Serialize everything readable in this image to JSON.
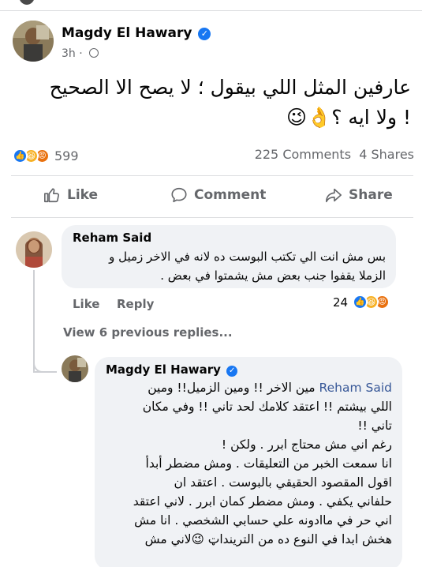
{
  "post": {
    "author": "Magdy El Hawary",
    "time": "3h",
    "text_line1": "عارفين المثل اللي بيقول ؛ لا يصح الا الصحيح",
    "text_line2": "! ولا ايه ؟👌😉"
  },
  "stats": {
    "reaction_count": "599",
    "comments": "225 Comments",
    "shares": "4 Shares"
  },
  "actions": {
    "like": "Like",
    "comment": "Comment",
    "share": "Share"
  },
  "comment": {
    "author": "Reham Said",
    "line1": "بس مش انت الي تكتب البوست ده لانه في الاخر زميل و",
    "line2": "الزملا يقفوا جنب بعض مش يشمتوا في بعض .",
    "like_label": "Like",
    "reply_label": "Reply",
    "reaction_count": "24"
  },
  "previous_replies": "View 6 previous replies...",
  "reply": {
    "author": "Magdy El Hawary",
    "mention": "Reham Said",
    "line1_rest": " مين الاخر !! ومين الزميل!! ومين",
    "line2": "اللي بيشتم !! اعتقد كلامك لحد تاني !! وفي مكان",
    "line3": "تاني !!",
    "line4": "رغم اني مش محتاج ابرر . ولكن !",
    "line5": "انا سمعت الخبر من التعليقات . ومش مضطر أبدأ",
    "line6": "اقول المقصود الحقيقي بالبوست . اعتقد ان",
    "line7": "حلفاني يكفي . ومش مضطر كمان ابرر . لاني اعتقد",
    "line8": "اني حر في ماادونه علي حسابي الشخصي . انا مش",
    "line9": "هخش ابدا في النوع ده من الترينداټ 😉لاني مش"
  },
  "colors": {
    "facebook_blue": "#1877f2",
    "bubble_gray": "#f0f2f5",
    "secondary_text": "#65676b",
    "mention_blue": "#385898"
  }
}
